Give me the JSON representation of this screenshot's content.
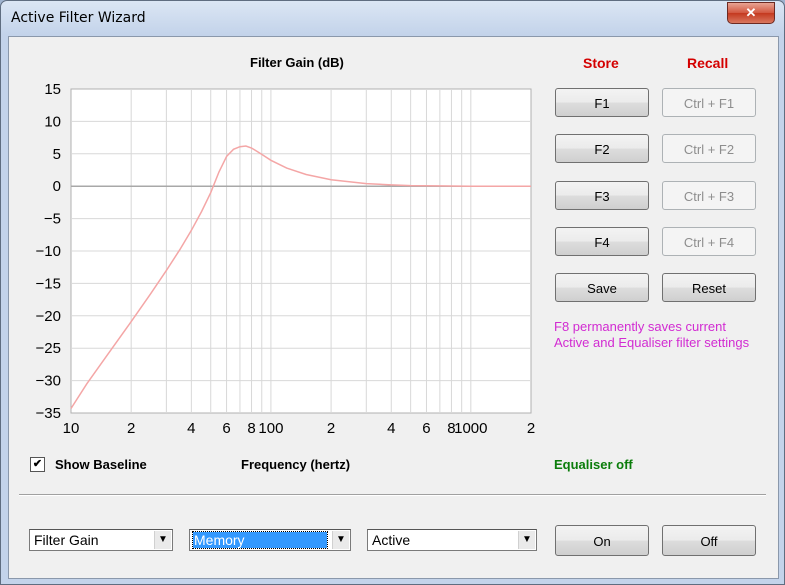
{
  "window": {
    "title": "Active Filter Wizard",
    "close_glyph": "✕"
  },
  "chart_data": {
    "type": "line",
    "title": "Filter Gain (dB)",
    "xlabel": "Frequency (hertz)",
    "ylabel": "",
    "xscale": "log",
    "xlim": [
      10,
      2000
    ],
    "ylim": [
      -35,
      15
    ],
    "yticks": [
      15,
      10,
      5,
      0,
      -5,
      -10,
      -15,
      -20,
      -25,
      -30,
      -35
    ],
    "xtick_labels": [
      {
        "x": 10,
        "label": "10"
      },
      {
        "x": 20,
        "label": "2"
      },
      {
        "x": 40,
        "label": "4"
      },
      {
        "x": 60,
        "label": "6"
      },
      {
        "x": 80,
        "label": "8"
      },
      {
        "x": 100,
        "label": "100"
      },
      {
        "x": 200,
        "label": "2"
      },
      {
        "x": 400,
        "label": "4"
      },
      {
        "x": 600,
        "label": "6"
      },
      {
        "x": 800,
        "label": "8"
      },
      {
        "x": 1000,
        "label": "1000"
      },
      {
        "x": 2000,
        "label": "2"
      }
    ],
    "grid": true,
    "series": [
      {
        "color": "#f4a6a6",
        "x": [
          10,
          12,
          15,
          20,
          25,
          30,
          35,
          40,
          45,
          50,
          55,
          60,
          65,
          70,
          75,
          80,
          90,
          100,
          120,
          150,
          200,
          300,
          400,
          500,
          700,
          1000,
          1500,
          2000
        ],
        "y": [
          -34.3,
          -30.5,
          -26.3,
          -20.9,
          -16.6,
          -13.0,
          -9.8,
          -6.8,
          -3.9,
          -1.0,
          2.2,
          4.6,
          5.7,
          6.1,
          6.2,
          5.9,
          4.9,
          4.0,
          2.8,
          1.8,
          1.0,
          0.4,
          0.2,
          0.1,
          0.05,
          0.0,
          0.0,
          0.0
        ]
      }
    ],
    "baseline": {
      "y": 0,
      "color": "#a8a8a8"
    }
  },
  "headers": {
    "store": "Store",
    "recall": "Recall"
  },
  "store_buttons": [
    "F1",
    "F2",
    "F3",
    "F4"
  ],
  "recall_buttons": [
    "Ctrl + F1",
    "Ctrl + F2",
    "Ctrl + F3",
    "Ctrl + F4"
  ],
  "actions": {
    "save": "Save",
    "reset": "Reset",
    "on": "On",
    "off": "Off"
  },
  "note": {
    "line1": "F8 permanently saves current",
    "line2": "Active and Equaliser filter settings"
  },
  "status": {
    "equaliser": "Equaliser off"
  },
  "show_baseline": {
    "label": "Show Baseline",
    "checked": true,
    "check_glyph": "✔"
  },
  "dropdowns": {
    "display": {
      "value": "Filter Gain"
    },
    "source": {
      "value": "Memory"
    },
    "filter": {
      "value": "Active"
    },
    "arrow_glyph": "▼"
  },
  "colors": {
    "store_header": "#d40000",
    "note": "#d22bd2",
    "status": "#0b7d0b",
    "curve": "#f4a6a6"
  }
}
